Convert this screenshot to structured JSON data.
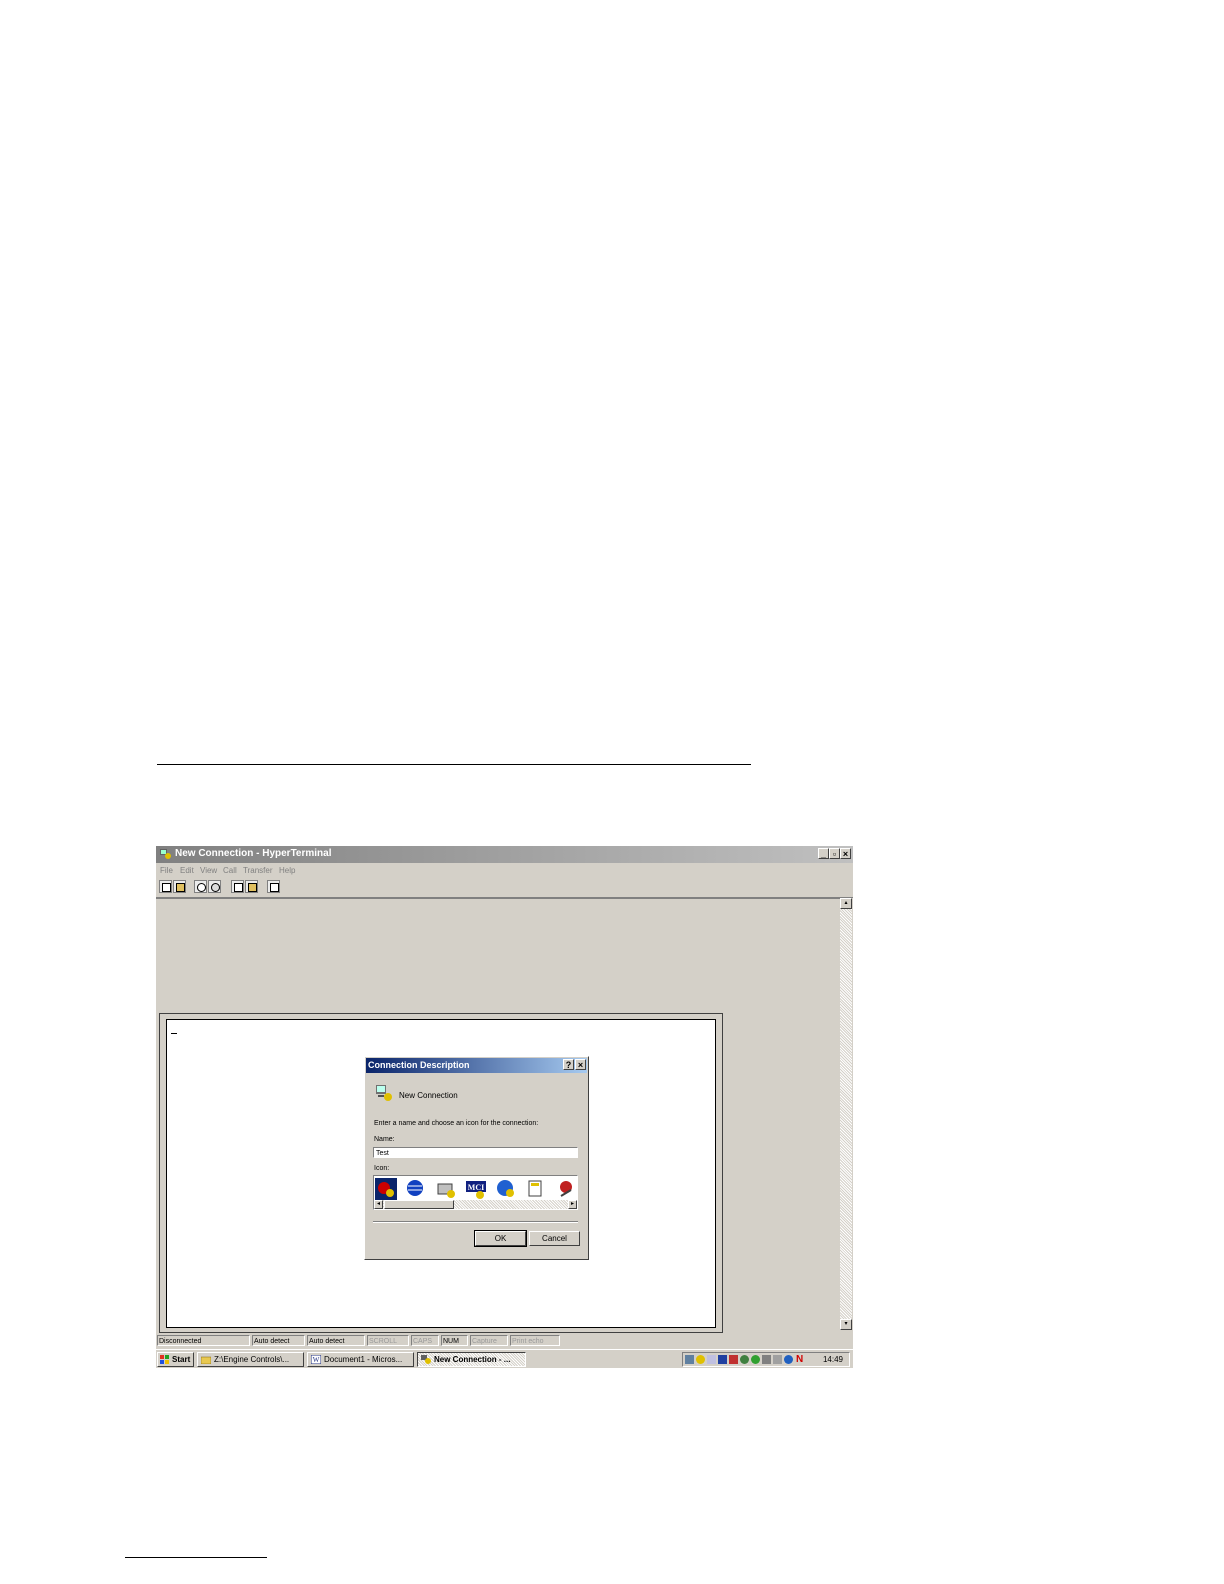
{
  "window": {
    "title": "New Connection - HyperTerminal",
    "menus": [
      "File",
      "Edit",
      "View",
      "Call",
      "Transfer",
      "Help"
    ],
    "toolbar_icons": [
      "new-icon",
      "open-icon",
      "connect-icon",
      "disconnect-icon",
      "send-icon",
      "receive-icon",
      "properties-icon"
    ]
  },
  "dialog": {
    "title": "Connection Description",
    "heading": "New Connection",
    "prompt": "Enter a name and choose an icon for the connection:",
    "name_label": "Name:",
    "name_value": "Test",
    "icon_label": "Icon:",
    "icon_mci_text": "MCI",
    "ok_label": "OK",
    "cancel_label": "Cancel"
  },
  "statusbar": {
    "panes": [
      "Disconnected",
      "Auto detect",
      "Auto detect",
      "SCROLL",
      "CAPS",
      "NUM",
      "Capture",
      "Print echo"
    ]
  },
  "taskbar": {
    "start_label": "Start",
    "items": [
      "Z:\\Engine Controls\\...",
      "Document1 - Micros...",
      "New Connection - ..."
    ],
    "clock": "14:49",
    "tray_n": "N"
  },
  "colors": {
    "dialog_title": "#0a246a",
    "window_face": "#d4d0c8"
  }
}
